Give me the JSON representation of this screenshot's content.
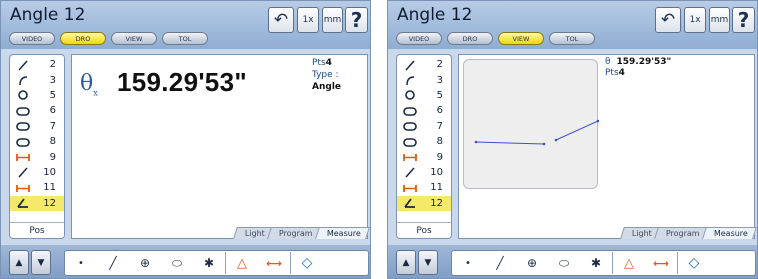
{
  "panels": [
    {
      "title": "Angle 12",
      "modes": [
        "VIDEO",
        "DRO",
        "VIEW",
        "TOL"
      ],
      "active_mode": "DRO",
      "toolbar": {
        "undo": "↶",
        "zoom": "1x",
        "units": "mm",
        "help": "?"
      },
      "features": [
        {
          "num": "2",
          "icon": "line-icon"
        },
        {
          "num": "3",
          "icon": "arc-icon"
        },
        {
          "num": "5",
          "icon": "circle-icon"
        },
        {
          "num": "6",
          "icon": "slot-icon"
        },
        {
          "num": "7",
          "icon": "slot-icon"
        },
        {
          "num": "8",
          "icon": "slot-icon"
        },
        {
          "num": "9",
          "icon": "distance-icon"
        },
        {
          "num": "10",
          "icon": "line-icon"
        },
        {
          "num": "11",
          "icon": "distance-icon"
        },
        {
          "num": "12",
          "icon": "angle-icon",
          "selected": true
        }
      ],
      "pos_label": "Pos",
      "dro": {
        "symbol": "θ",
        "subscript": "x",
        "value": "159.29'53\"",
        "pts_label": "Pts",
        "pts_value": "4",
        "type_label": "Type : ",
        "type_value": "Angle"
      },
      "tabs": [
        "Light",
        "Program",
        "Measure"
      ],
      "active_tab": "Measure"
    },
    {
      "title": "Angle 12",
      "modes": [
        "VIDEO",
        "DRO",
        "VIEW",
        "TOL"
      ],
      "active_mode": "VIEW",
      "toolbar": {
        "undo": "↶",
        "zoom": "1x",
        "units": "mm",
        "help": "?"
      },
      "features": [
        {
          "num": "2",
          "icon": "line-icon"
        },
        {
          "num": "3",
          "icon": "arc-icon"
        },
        {
          "num": "5",
          "icon": "circle-icon"
        },
        {
          "num": "6",
          "icon": "slot-icon"
        },
        {
          "num": "7",
          "icon": "slot-icon"
        },
        {
          "num": "8",
          "icon": "slot-icon"
        },
        {
          "num": "9",
          "icon": "distance-icon"
        },
        {
          "num": "10",
          "icon": "line-icon"
        },
        {
          "num": "11",
          "icon": "distance-icon"
        },
        {
          "num": "12",
          "icon": "angle-icon",
          "selected": true
        }
      ],
      "pos_label": "Pos",
      "view": {
        "symbol": "θ",
        "value": "159.29'53\"",
        "pts_label": "Pts",
        "pts_value": "4"
      },
      "tabs": [
        "Light",
        "Program",
        "Measure"
      ],
      "active_tab": "Measure"
    }
  ],
  "measure_tools": [
    {
      "name": "point-tool",
      "glyph": "•"
    },
    {
      "name": "line-tool",
      "glyph": "╱"
    },
    {
      "name": "circle-tool",
      "glyph": "⊕"
    },
    {
      "name": "slot-tool",
      "glyph": "⬭"
    },
    {
      "name": "magic-tool",
      "glyph": "✱"
    },
    {
      "name": "angle-tool",
      "glyph": "△"
    },
    {
      "name": "distance-tool",
      "glyph": "⟷"
    },
    {
      "name": "probe-tool",
      "glyph": "◇"
    }
  ],
  "nav": {
    "up": "▲",
    "down": "▼"
  },
  "colors": {
    "active_mode": "#f0d800",
    "selected_row": "#f5e96a",
    "accent": "#2a5aa0",
    "measure_orange": "#e05a1a"
  }
}
